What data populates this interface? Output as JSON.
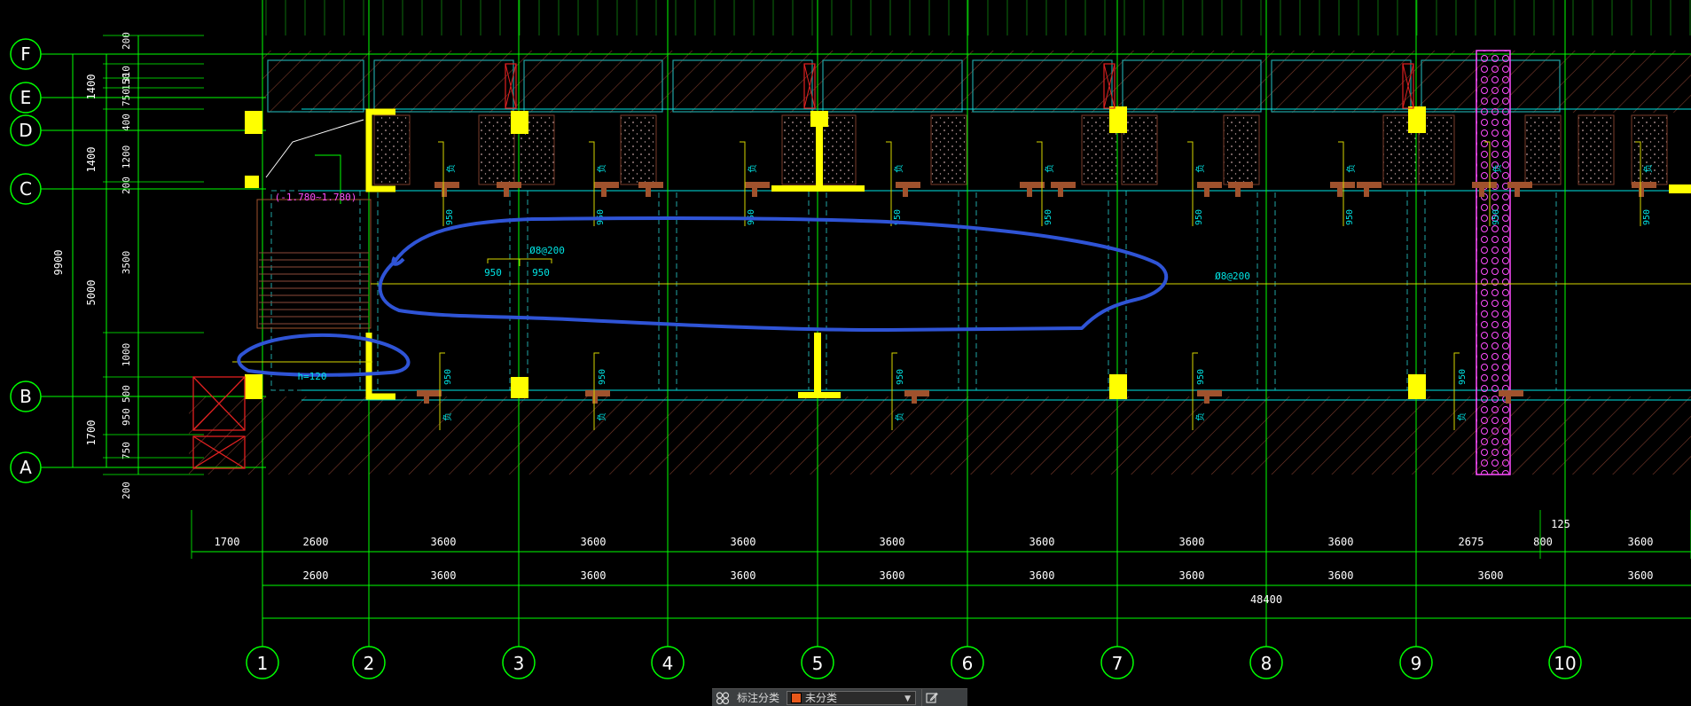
{
  "drawing": {
    "grid_rows": [
      {
        "label": "F"
      },
      {
        "label": "E"
      },
      {
        "label": "D"
      },
      {
        "label": "C"
      },
      {
        "label": "B"
      },
      {
        "label": "A"
      }
    ],
    "grid_cols": [
      {
        "label": "1"
      },
      {
        "label": "2"
      },
      {
        "label": "3"
      },
      {
        "label": "4"
      },
      {
        "label": "5"
      },
      {
        "label": "6"
      },
      {
        "label": "7"
      },
      {
        "label": "8"
      },
      {
        "label": "9"
      },
      {
        "label": "10"
      }
    ],
    "left_dims_outer": [
      "9900"
    ],
    "left_dims_mid": [
      "1400",
      "1400",
      "5000",
      "1700"
    ],
    "left_dims_inner": [
      "200",
      "310",
      "150",
      "750",
      "400",
      "1200",
      "200",
      "3500",
      "1000",
      "500",
      "950",
      "750",
      "200"
    ],
    "dim_row1": [
      "1700",
      "2600",
      "3600",
      "3600",
      "3600",
      "3600",
      "3600",
      "3600",
      "3600",
      "2675",
      "800",
      "3600"
    ],
    "dim_row1_extra": "125",
    "dim_row2": [
      "2600",
      "3600",
      "3600",
      "3600",
      "3600",
      "3600",
      "3600",
      "3600",
      "3600",
      "3600"
    ],
    "dim_total": "48400",
    "labels": {
      "stair_elev": "(-1.780~1.780)",
      "slab_thick": "h=120",
      "rebar_main": "Ø8@200",
      "rebar_right": "Ø8@200",
      "small_950a": "950",
      "small_950b": "950"
    },
    "colors": {
      "axis": "#00ff00",
      "column": "#ffff00",
      "hatch": "#7a3b2a",
      "cyan": "#00e5e5",
      "beam": "#1fa3a3",
      "markup": "#2f54d6",
      "magenta": "#ff4dff",
      "red": "#e02020",
      "brown": "#a0522d",
      "white": "#ffffff",
      "yellow_line": "#d6d600"
    }
  },
  "annotation_bar": {
    "label": "标注分类",
    "selected_category": "未分类",
    "swatch_color": "#e8581a"
  }
}
